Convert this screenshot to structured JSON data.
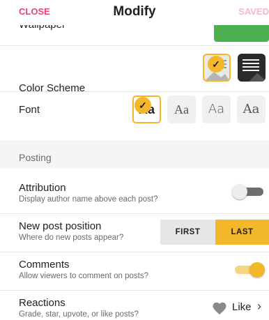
{
  "header": {
    "close_label": "CLOSE",
    "title": "Modify",
    "saved_label": "SAVED"
  },
  "appearance": {
    "wallpaper_label": "Wallpaper",
    "color_scheme_label": "Color Scheme",
    "font_label": "Font",
    "font_options": [
      "Aa",
      "Aa",
      "Aa",
      "Aa"
    ],
    "selected_font_index": 0,
    "selected_scheme": "light"
  },
  "posting": {
    "section_title": "Posting",
    "attribution": {
      "label": "Attribution",
      "sub": "Display author name above each post?",
      "enabled": false
    },
    "new_post_position": {
      "label": "New post position",
      "sub": "Where do new posts appear?",
      "options": [
        "FIRST",
        "LAST"
      ],
      "selected": "LAST"
    },
    "comments": {
      "label": "Comments",
      "sub": "Allow viewers to comment on posts?",
      "enabled": true
    },
    "reactions": {
      "label": "Reactions",
      "sub": "Grade, star, upvote, or like posts?",
      "value": "Like",
      "icon": "heart-icon"
    }
  },
  "colors": {
    "accent": "#f3b829",
    "close": "#e8437a",
    "saved": "#f7b6cc",
    "wallpaper": "#4caf50"
  }
}
